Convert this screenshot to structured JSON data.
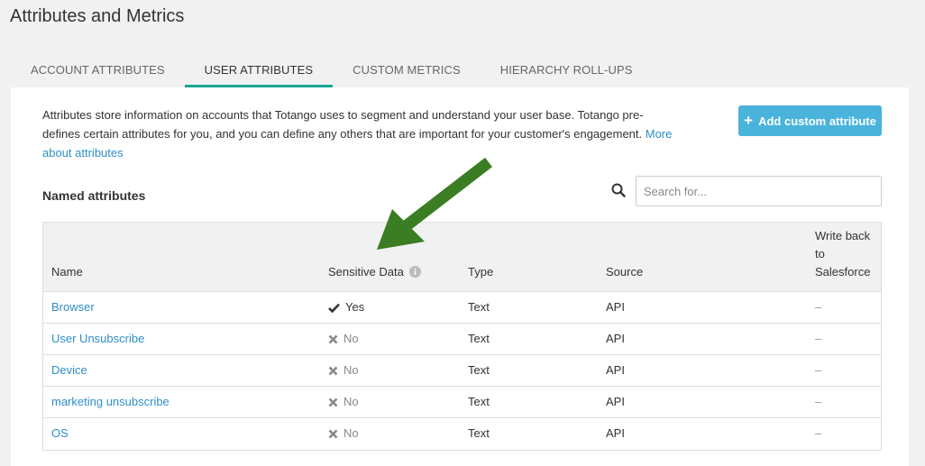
{
  "page": {
    "title": "Attributes and Metrics"
  },
  "tabs": [
    {
      "label": "ACCOUNT ATTRIBUTES"
    },
    {
      "label": "USER ATTRIBUTES"
    },
    {
      "label": "CUSTOM METRICS"
    },
    {
      "label": "HIERARCHY ROLL-UPS"
    }
  ],
  "intro": {
    "text": "Attributes store information on accounts that Totango uses to segment and understand your user base. Totango pre-defines certain attributes for you, and you can define any others that are important for your customer's engagement. ",
    "link": "More about attributes"
  },
  "add_button": {
    "label": "Add custom attribute"
  },
  "section": {
    "title": "Named attributes"
  },
  "search": {
    "placeholder": "Search for..."
  },
  "table": {
    "headers": {
      "name": "Name",
      "sensitive": "Sensitive Data",
      "type": "Type",
      "source": "Source",
      "writeback_1": "Write back",
      "writeback_2": "to",
      "writeback_3": "Salesforce"
    },
    "rows": [
      {
        "name": "Browser",
        "sensitive": "Yes",
        "type": "Text",
        "source": "API",
        "writeback": "–"
      },
      {
        "name": "User Unsubscribe",
        "sensitive": "No",
        "type": "Text",
        "source": "API",
        "writeback": "–"
      },
      {
        "name": "Device",
        "sensitive": "No",
        "type": "Text",
        "source": "API",
        "writeback": "–"
      },
      {
        "name": "marketing unsubscribe",
        "sensitive": "No",
        "type": "Text",
        "source": "API",
        "writeback": "–"
      },
      {
        "name": "OS",
        "sensitive": "No",
        "type": "Text",
        "source": "API",
        "writeback": "–"
      }
    ]
  },
  "colors": {
    "accent": "#1aa794",
    "button": "#49b3dc",
    "link": "#2f8ec9",
    "arrow": "#3b7d23"
  }
}
